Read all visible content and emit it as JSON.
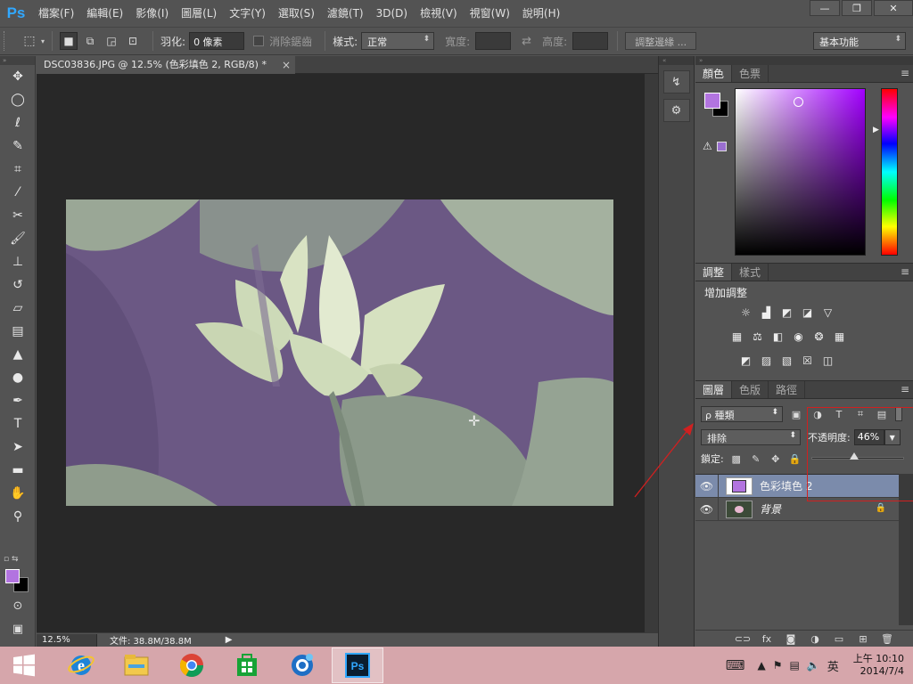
{
  "app": {
    "logo": "Ps",
    "menu": [
      "檔案(F)",
      "編輯(E)",
      "影像(I)",
      "圖層(L)",
      "文字(Y)",
      "選取(S)",
      "濾鏡(T)",
      "3D(D)",
      "檢視(V)",
      "視窗(W)",
      "說明(H)"
    ],
    "window_controls": {
      "minimize": "—",
      "restore": "❐",
      "close": "✕"
    }
  },
  "options": {
    "feather_label": "羽化:",
    "feather_value": "0 像素",
    "antialias_label": "消除鋸齒",
    "style_label": "樣式:",
    "style_value": "正常",
    "width_label": "寬度:",
    "swap_icon": "⇄",
    "height_label": "高度:",
    "refine_edge_button": "調整邊緣 ...",
    "workspace_value": "基本功能"
  },
  "document": {
    "tab_title": "DSC03836.JPG @ 12.5% (色彩填色 2, RGB/8) *",
    "tab_close": "×",
    "zoom": "12.5%",
    "doc_info": "文件: 38.8M/38.8M",
    "status_arrow": "▶"
  },
  "tools": {
    "fg_color": "#b274e0",
    "bg_color": "#000000",
    "icons": [
      "move-icon",
      "marquee-ellipse-icon",
      "lasso-icon",
      "quick-selection-icon",
      "crop-icon",
      "eyedropper-icon",
      "healing-brush-icon",
      "brush-icon",
      "clone-stamp-icon",
      "history-brush-icon",
      "eraser-icon",
      "gradient-icon",
      "blur-icon",
      "dodge-icon",
      "pen-icon",
      "type-icon",
      "path-selection-icon",
      "rectangle-icon",
      "hand-icon",
      "zoom-icon"
    ]
  },
  "color_panel": {
    "tabs": [
      "顏色",
      "色票"
    ],
    "foreground": "#b274e0",
    "background": "#000000",
    "gamut_warning_icon": "⚠"
  },
  "adjustments_panel": {
    "tabs": [
      "調整",
      "樣式"
    ],
    "title": "增加調整"
  },
  "layers_panel": {
    "tabs": [
      "圖層",
      "色版",
      "路徑"
    ],
    "kind_filter": "ρ 種類",
    "blend_mode": "排除",
    "opacity_label": "不透明度:",
    "opacity_value": "46%",
    "opacity_percent": 46,
    "lock_label": "鎖定:",
    "layers": [
      {
        "name": "色彩填色 2",
        "selected": true,
        "type": "fill",
        "color": "#b274e0"
      },
      {
        "name": "背景",
        "selected": false,
        "type": "image",
        "locked": true
      }
    ]
  },
  "taskbar": {
    "ime": "英",
    "time": "上午 10:10",
    "date": "2014/7/4",
    "apps": [
      "internet-explorer",
      "file-explorer",
      "chrome",
      "store",
      "messenger",
      "photoshop"
    ]
  },
  "annotation": {
    "color": "#d02020"
  }
}
